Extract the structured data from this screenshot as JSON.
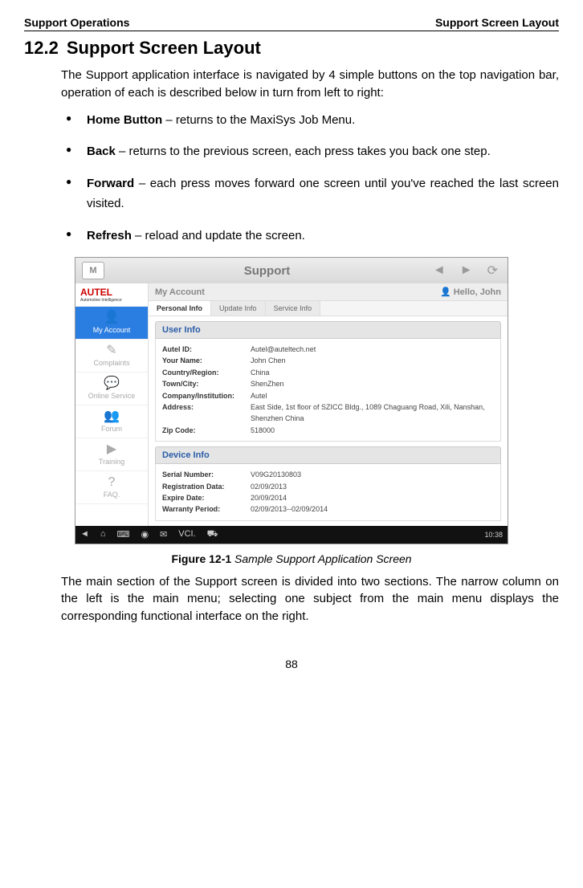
{
  "header": {
    "left": "Support Operations",
    "right": "Support Screen Layout"
  },
  "section": {
    "number": "12.2",
    "title": "Support Screen Layout",
    "intro": "The Support application interface is navigated by 4 simple buttons on the top navigation bar, operation of each is described below in turn from left to right:",
    "bullets": [
      {
        "term": "Home Button",
        "desc": " – returns to the MaxiSys Job Menu."
      },
      {
        "term": "Back",
        "desc": " – returns to the previous screen, each press takes you back one step."
      },
      {
        "term": "Forward",
        "desc": " – each press moves forward one screen until you've reached the last screen visited."
      },
      {
        "term": "Refresh",
        "desc": " – reload and update the screen."
      }
    ],
    "outro": "The main section of the Support screen is divided into two sections. The narrow column on the left is the main menu; selecting one subject from the main menu displays the corresponding functional interface on the right."
  },
  "figure": {
    "label": "Figure 12-1",
    "caption": "Sample Support Application Screen"
  },
  "screenshot": {
    "topbar": {
      "home": "M",
      "title": "Support",
      "back": "◄",
      "forward": "►",
      "refresh": "⟳"
    },
    "logo": "AUTEL",
    "logo_sub": "Automotive Intelligence",
    "sidebar": [
      {
        "icon": "👤",
        "label": "My Account",
        "active": true
      },
      {
        "icon": "✎",
        "label": "Complaints",
        "active": false
      },
      {
        "icon": "💬",
        "label": "Online Service",
        "active": false
      },
      {
        "icon": "👥",
        "label": "Forum",
        "active": false
      },
      {
        "icon": "▶",
        "label": "Training",
        "active": false
      },
      {
        "icon": "?",
        "label": "FAQ.",
        "active": false
      }
    ],
    "account_bar": {
      "title": "My Account",
      "user_prefix": "Hello, ",
      "user": "John"
    },
    "tabs": [
      {
        "label": "Personal Info",
        "active": true
      },
      {
        "label": "Update Info",
        "active": false
      },
      {
        "label": "Service Info",
        "active": false
      }
    ],
    "user_info": {
      "header": "User Info",
      "rows": [
        {
          "label": "Autel ID:",
          "value": "Autel@auteltech.net"
        },
        {
          "label": "Your Name:",
          "value": "John Chen"
        },
        {
          "label": "Country/Region:",
          "value": "China"
        },
        {
          "label": "Town/City:",
          "value": "ShenZhen"
        },
        {
          "label": "Company/Institution:",
          "value": "Autel"
        },
        {
          "label": "Address:",
          "value": "East Side, 1st floor of SZICC Bldg., 1089 Chaguang Road, Xili, Nanshan, Shenzhen China"
        },
        {
          "label": "Zip Code:",
          "value": "518000"
        }
      ]
    },
    "device_info": {
      "header": "Device Info",
      "rows": [
        {
          "label": "Serial Number:",
          "value": "V09G20130803"
        },
        {
          "label": "Registration Data:",
          "value": "02/09/2013"
        },
        {
          "label": "Expire Date:",
          "value": "20/09/2014"
        },
        {
          "label": "Warranty Period:",
          "value": "02/09/2013--02/09/2014"
        }
      ]
    },
    "bottombar": {
      "icons": [
        "◄",
        "⌂",
        "⌨",
        "◉",
        "✉",
        "VCI.",
        "⛟"
      ],
      "status": "10:38"
    }
  },
  "page_number": "88"
}
